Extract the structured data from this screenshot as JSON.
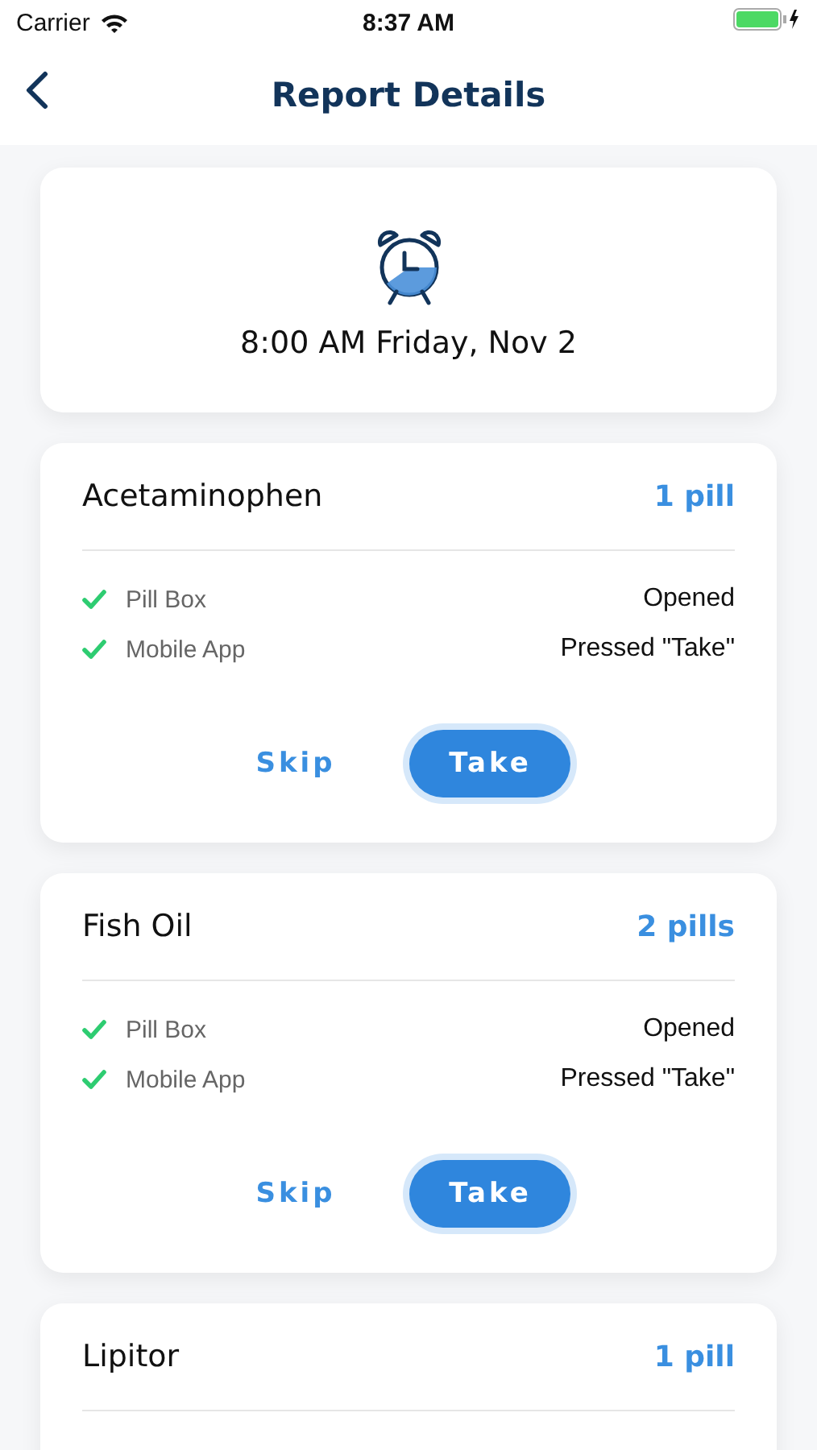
{
  "status_bar": {
    "carrier": "Carrier",
    "time": "8:37 AM"
  },
  "nav": {
    "title": "Report Details"
  },
  "schedule": {
    "time": "8:00 AM Friday, Nov 2"
  },
  "medications": [
    {
      "name": "Acetaminophen",
      "dose": "1 pill",
      "events": [
        {
          "source": "Pill Box",
          "result": "Opened",
          "checked": true
        },
        {
          "source": "Mobile App",
          "result": "Pressed \"Take\"",
          "checked": true
        }
      ],
      "buttons": [
        {
          "label": "Skip",
          "kind": "text"
        },
        {
          "label": "Take",
          "kind": "filled"
        }
      ]
    },
    {
      "name": "Fish Oil",
      "dose": "2 pills",
      "events": [
        {
          "source": "Pill Box",
          "result": "Opened",
          "checked": true
        },
        {
          "source": "Mobile App",
          "result": "Pressed \"Take\"",
          "checked": true
        }
      ],
      "buttons": [
        {
          "label": "Skip",
          "kind": "text"
        },
        {
          "label": "Take",
          "kind": "filled"
        }
      ]
    },
    {
      "name": "Lipitor",
      "dose": "1 pill"
    }
  ]
}
